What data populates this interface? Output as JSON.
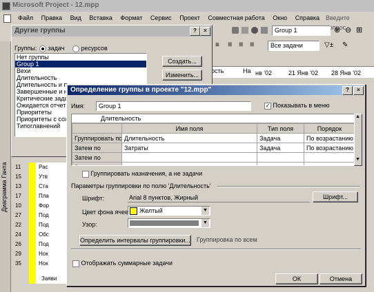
{
  "app": {
    "title": "Microsoft Project - 12.mpp"
  },
  "menu": [
    "Файл",
    "Правка",
    "Вид",
    "Вставка",
    "Формат",
    "Сервис",
    "Проект",
    "Совместная работа",
    "Окно",
    "Справка"
  ],
  "help_box_placeholder": "Введите вопрос",
  "toolbar": {
    "group_value": "Group 1",
    "filter_value": "Все задачи"
  },
  "groups_dialog": {
    "title": "Другие группы",
    "groups_label": "Группы:",
    "radio_tasks": "задач",
    "radio_resources": "ресурсов",
    "list": [
      "Нет группы",
      "Group 1",
      "Вехи",
      "Длительность",
      "Длительность и п",
      "Завершенные и н",
      "Критические зада",
      "Ожидается отчет",
      "Приоритеты",
      "Приоритеты с сохр",
      "Типоглавнений"
    ],
    "selected_index": 1,
    "create_button": "Создать...",
    "edit_button": "Изменить..."
  },
  "timeline": {
    "label_ost": "ость",
    "label_na": "На",
    "weeks": [
      "нв '02",
      "21 Янв '02",
      "28 Янв '02"
    ]
  },
  "tasks": {
    "ids": [
      "11",
      "15",
      "13",
      "17",
      "10",
      "27",
      "22",
      "24",
      "26",
      "29",
      "35"
    ],
    "names": [
      "Рас",
      "Утв",
      "Ста",
      "Пла",
      "Фор",
      "Под",
      "Под",
      "Обс",
      "Под",
      "Нок",
      "Нок"
    ],
    "footer": "Заяви"
  },
  "sidebar_label": "Диаграмма Ганта",
  "main_dialog": {
    "title": "Определение группы в проекте \"12.mpp\"",
    "name_label": "Имя:",
    "name_value": "Group 1",
    "show_in_menu": "Показывать в меню",
    "field_row_value": "Длительность",
    "columns": [
      "Имя поля",
      "Тип поля",
      "Порядок"
    ],
    "rows": [
      {
        "label": "Группировать по",
        "field": "Длительность",
        "type": "Задача",
        "order": "По возрастанию"
      },
      {
        "label": "Затем по",
        "field": "Затраты",
        "type": "Задача",
        "order": "По возрастанию"
      },
      {
        "label": "Затем по",
        "field": "",
        "type": "",
        "order": ""
      },
      {
        "label": "Затем по",
        "field": "",
        "type": "",
        "order": ""
      }
    ],
    "group_assignments": "Группировать назначения, а не задачи",
    "params_title": "Параметры группировки по полю 'Длительность'",
    "font_label": "Шрифт:",
    "font_value": "Arial 8 пунктов, Жирный",
    "font_button": "Шрифт...",
    "cell_color_label": "Цвет фона ячеек:",
    "cell_color_value": "Желтый",
    "pattern_label": "Узор:",
    "intervals_button": "Определить интервалы группировки...",
    "intervals_text": "Группировка по всем",
    "show_summary": "Отображать суммарные задачи",
    "ok": "ОК",
    "cancel": "Отмена",
    "help": "?",
    "close": "×"
  },
  "colors": {
    "title_blue": "#0a246a",
    "highlight": "#0a246a",
    "yellow": "#ffff00",
    "pattern_gray": "#808080"
  }
}
